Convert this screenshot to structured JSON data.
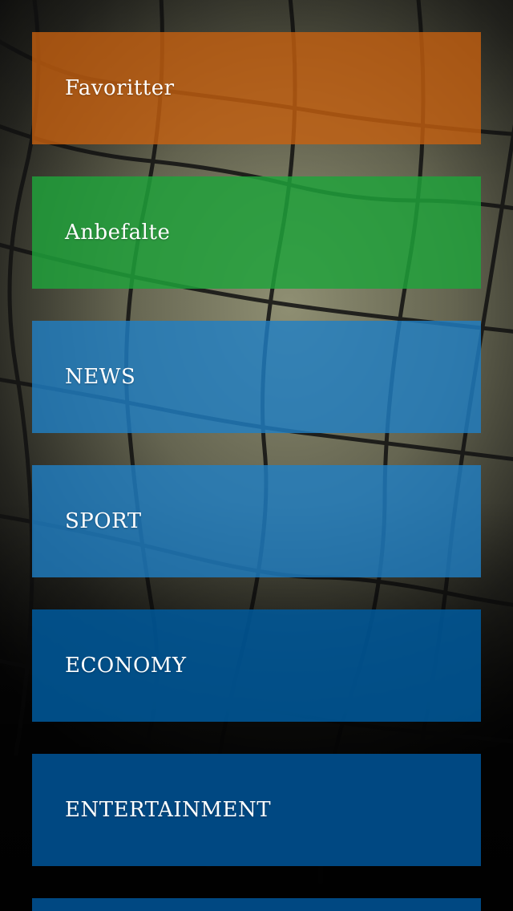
{
  "menu": {
    "items": [
      {
        "label": "Favoritter",
        "color": "#c9620f"
      },
      {
        "label": "Anbefalte",
        "color": "#1fa33a"
      },
      {
        "label": "NEWS",
        "color": "#1f80c5"
      },
      {
        "label": "SPORT",
        "color": "#1f80c5"
      },
      {
        "label": "ECONOMY",
        "color": "#005a9c"
      },
      {
        "label": "ENTERTAINMENT",
        "color": "#005090"
      }
    ]
  }
}
